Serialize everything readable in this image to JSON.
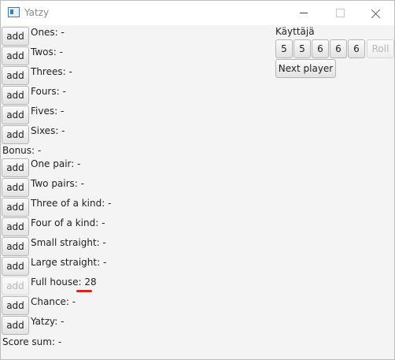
{
  "window": {
    "title": "Yatzy",
    "accent_color": "#cc2a1e"
  },
  "categories": [
    {
      "add_label": "add",
      "label": "Ones: -"
    },
    {
      "add_label": "add",
      "label": "Twos: -"
    },
    {
      "add_label": "add",
      "label": "Threes: -"
    },
    {
      "add_label": "add",
      "label": "Fours: -"
    },
    {
      "add_label": "add",
      "label": "Fives: -"
    },
    {
      "add_label": "add",
      "label": "Sixes: -"
    },
    {
      "add_label": "add",
      "label": "One pair: -"
    },
    {
      "add_label": "add",
      "label": "Two pairs: -"
    },
    {
      "add_label": "add",
      "label": "Three of a kind: -"
    },
    {
      "add_label": "add",
      "label": "Four of a kind: -"
    },
    {
      "add_label": "add",
      "label": "Small straight: -"
    },
    {
      "add_label": "add",
      "label": "Large straight: -"
    },
    {
      "add_label": "add",
      "label": "Full house: 28",
      "disabled": true
    },
    {
      "add_label": "add",
      "label": "Chance: -"
    },
    {
      "add_label": "add",
      "label": "Yatzy: -"
    }
  ],
  "bonus_label": "Bonus: -",
  "score_sum_label": "Score sum: -",
  "player": {
    "name": "Käyttäjä",
    "dice": [
      "5",
      "5",
      "6",
      "6",
      "6"
    ],
    "roll_label": "Roll",
    "next_player_label": "Next player"
  }
}
